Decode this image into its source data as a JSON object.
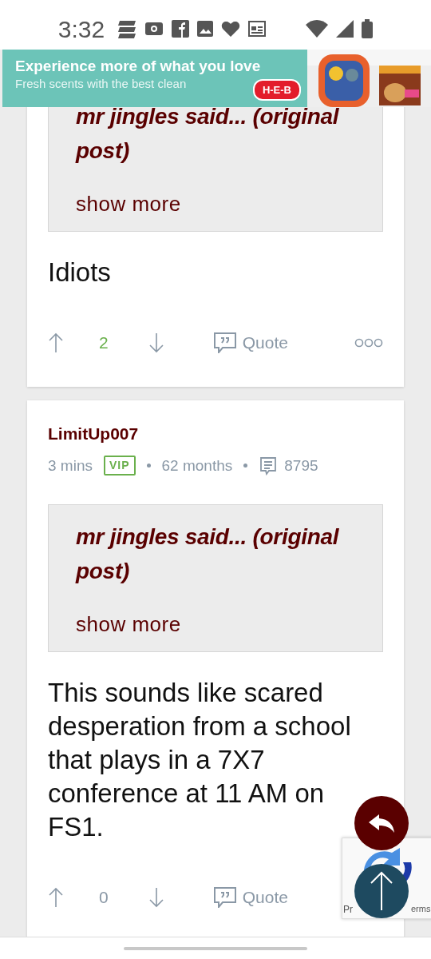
{
  "status_bar": {
    "time": "3:32"
  },
  "ad": {
    "headline": "Experience more of what you love",
    "subline": "Fresh scents with the best clean",
    "logo": "H-E-B"
  },
  "posts": [
    {
      "quote": {
        "title": "mr jingles said... (original post)",
        "show_more": "show more"
      },
      "body": "Idiots",
      "score": "2",
      "color": "#6ab04c",
      "quote_button": "Quote",
      "more_menu": true
    },
    {
      "author": "LimitUp007",
      "time": "3 mins",
      "badge": "VIP",
      "tenure": "62 months",
      "post_count": "8795",
      "quote": {
        "title": "mr jingles said... (original post)",
        "show_more": "show more"
      },
      "body": "This sounds like scared desperation from a school that plays in a 7X7 conference at 11 AM on FS1.",
      "score": "0",
      "color": "#8a98a6",
      "quote_button": "Quote",
      "more_menu": false
    }
  ],
  "recaptcha": {
    "links_left": "Pr",
    "links_right": "erms"
  }
}
